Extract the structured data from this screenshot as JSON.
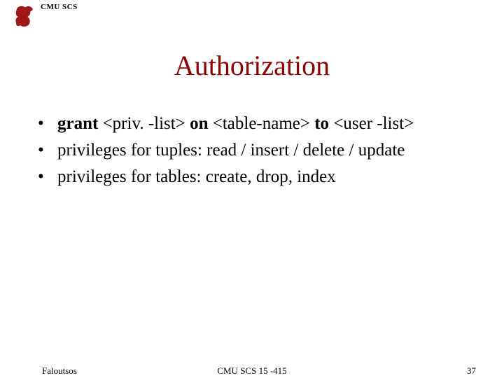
{
  "header": {
    "label": "CMU SCS",
    "logo_alt": "scotty-dog-icon"
  },
  "title": "Authorization",
  "bullets": [
    {
      "html": "<b>grant</b> &lt;priv. -list&gt; <b>on</b> &lt;table-name&gt; <b>to</b> &lt;user -list&gt;"
    },
    {
      "text": "privileges for tuples: read / insert / delete / update"
    },
    {
      "text": "privileges for tables: create, drop, index"
    }
  ],
  "footer": {
    "left": "Faloutsos",
    "center": "CMU SCS 15 -415",
    "right": "37"
  }
}
